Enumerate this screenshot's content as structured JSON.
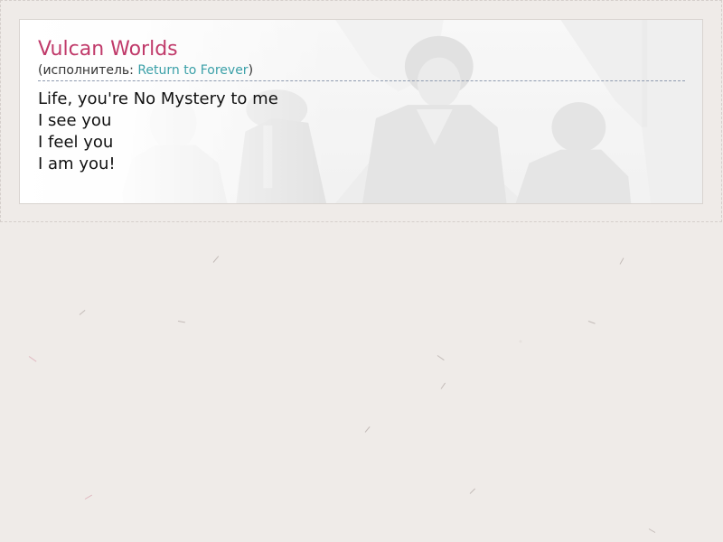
{
  "song": {
    "title": "Vulcan Worlds",
    "artist_prefix": "(исполнитель: ",
    "artist_name": "Return to Forever",
    "artist_suffix": ")"
  },
  "lyrics": [
    "Life, you're No Mystery to me",
    "I see you",
    "I feel you",
    "I am you!"
  ],
  "colors": {
    "title": "#c03a6a",
    "link": "#3ba0a8",
    "background": "#efebe8"
  }
}
